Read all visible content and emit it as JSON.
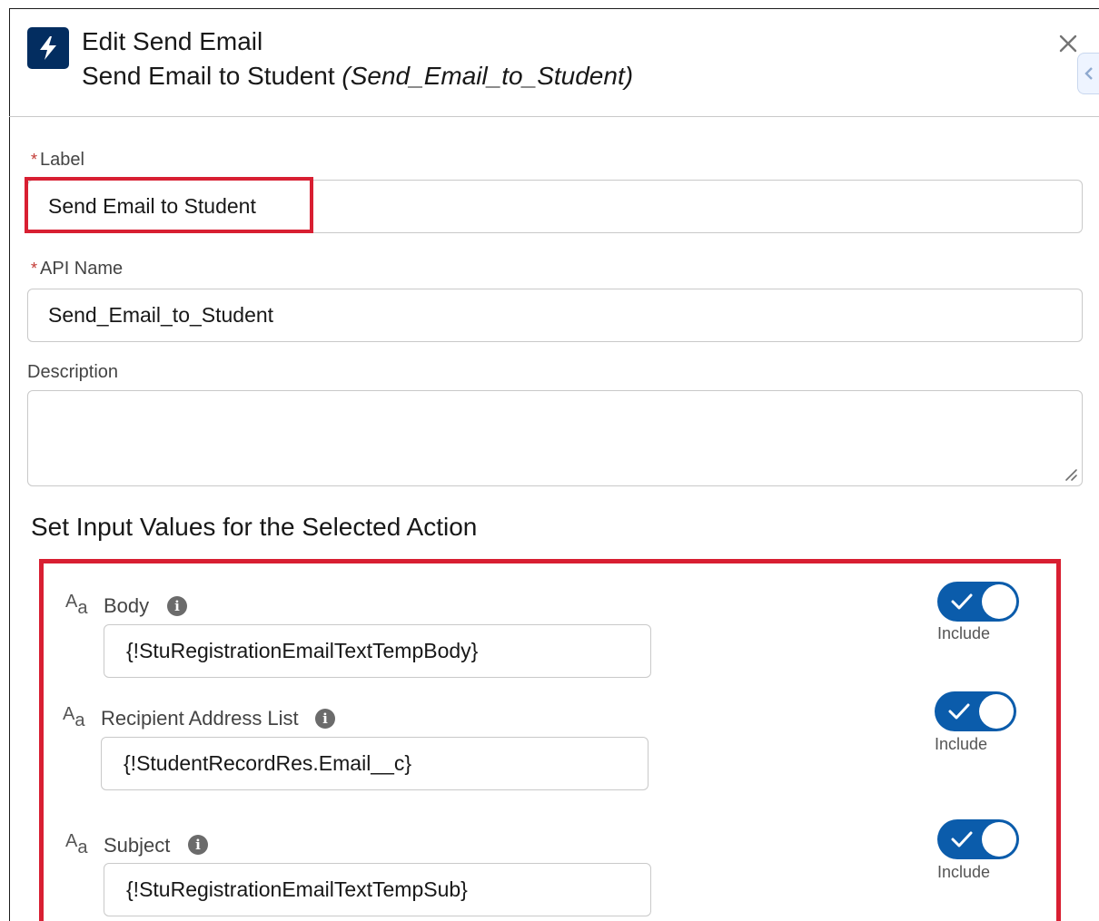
{
  "header": {
    "icon": "lightning-bolt-icon",
    "icon_bg": "#032d60",
    "title": "Edit Send Email",
    "subtitle": "Send Email to Student",
    "subtitle_api": "(Send_Email_to_Student)",
    "close": "×"
  },
  "form": {
    "required_mark": "*",
    "label": {
      "label": "Label",
      "value": "Send Email to Student"
    },
    "api_name": {
      "label": "API Name",
      "value": "Send_Email_to_Student"
    },
    "description": {
      "label": "Description",
      "value": ""
    }
  },
  "section": {
    "title": "Set Input Values for the Selected Action",
    "type_icon_big": "A",
    "type_icon_small": "a",
    "include_label": "Include",
    "params": [
      {
        "label": "Body",
        "value": "{!StuRegistrationEmailTextTempBody}",
        "include": true
      },
      {
        "label": "Recipient Address List",
        "value": "{!StudentRecordRes.Email__c}",
        "include": true
      },
      {
        "label": "Subject",
        "value": "{!StuRegistrationEmailTextTempSub}",
        "include": true
      }
    ]
  },
  "colors": {
    "highlight": "#d81f32",
    "toggle_on": "#0b5cab",
    "required": "#c23934"
  }
}
